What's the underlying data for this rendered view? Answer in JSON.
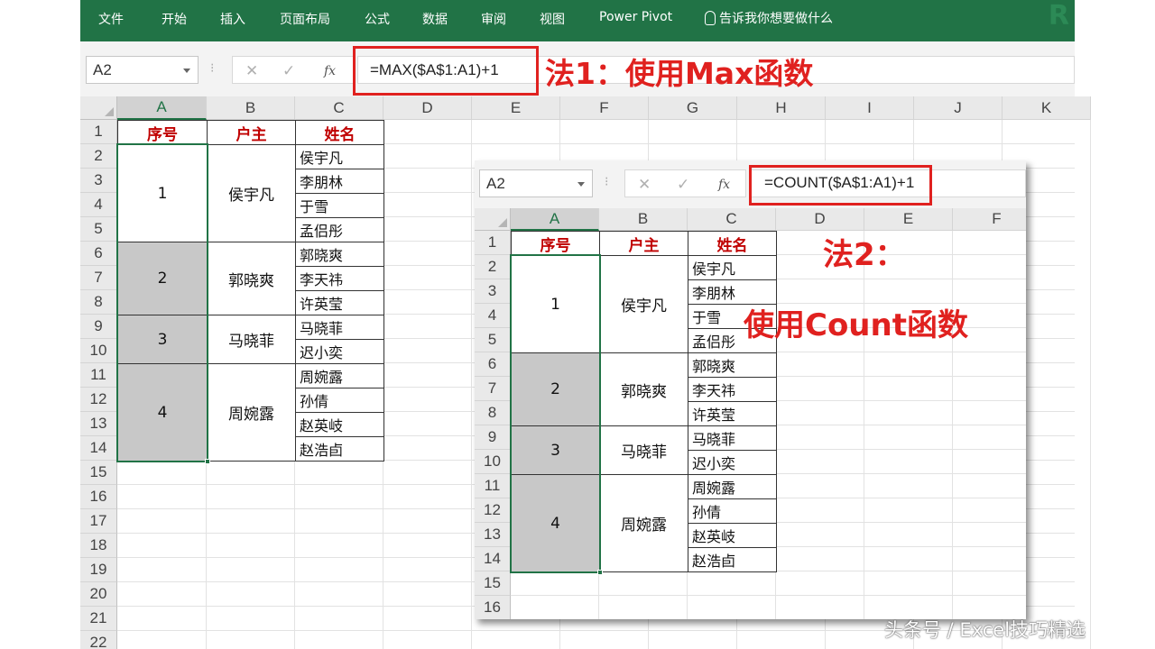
{
  "ribbon": {
    "tabs": [
      "文件",
      "开始",
      "插入",
      "页面布局",
      "公式",
      "数据",
      "审阅",
      "视图",
      "Power Pivot"
    ],
    "tell_me": "告诉我你想要做什么"
  },
  "sheet1": {
    "name_box": "A2",
    "formula": "=MAX($A$1:A1)+1",
    "annotation": "法1：使用Max函数",
    "columns": [
      "A",
      "B",
      "C",
      "D",
      "E",
      "F",
      "G",
      "H",
      "I",
      "J",
      "K"
    ],
    "rows": [
      "1",
      "2",
      "3",
      "4",
      "5",
      "6",
      "7",
      "8",
      "9",
      "10",
      "11",
      "12",
      "13",
      "14",
      "15",
      "16",
      "17",
      "18",
      "19",
      "20",
      "21",
      "22"
    ]
  },
  "sheet2": {
    "name_box": "A2",
    "formula": "=COUNT($A$1:A1)+1",
    "annotation_line1": "法2：",
    "annotation_line2": "使用Count函数",
    "columns": [
      "A",
      "B",
      "C",
      "D",
      "E",
      "F"
    ],
    "rows": [
      "1",
      "2",
      "3",
      "4",
      "5",
      "6",
      "7",
      "8",
      "9",
      "10",
      "11",
      "12",
      "13",
      "14",
      "15",
      "16"
    ]
  },
  "table": {
    "headers": [
      "序号",
      "户主",
      "姓名"
    ],
    "groups": [
      {
        "no": "1",
        "owner": "侯宇凡",
        "members": [
          "侯宇凡",
          "李朋林",
          "于雪",
          "孟侣彤"
        ]
      },
      {
        "no": "2",
        "owner": "郭晓爽",
        "members": [
          "郭晓爽",
          "李天祎",
          "许英莹"
        ]
      },
      {
        "no": "3",
        "owner": "马晓菲",
        "members": [
          "马晓菲",
          "迟小奕"
        ]
      },
      {
        "no": "4",
        "owner": "周婉露",
        "members": [
          "周婉露",
          "孙倩",
          "赵英岐",
          "赵浩卣"
        ]
      }
    ]
  },
  "watermark": "头条号 / Excel技巧精选",
  "colors": {
    "ribbon": "#217346",
    "annotation": "#e0211f",
    "header_text": "#c00000",
    "selection": "#217346",
    "gray_fill": "#c8c8c8"
  }
}
